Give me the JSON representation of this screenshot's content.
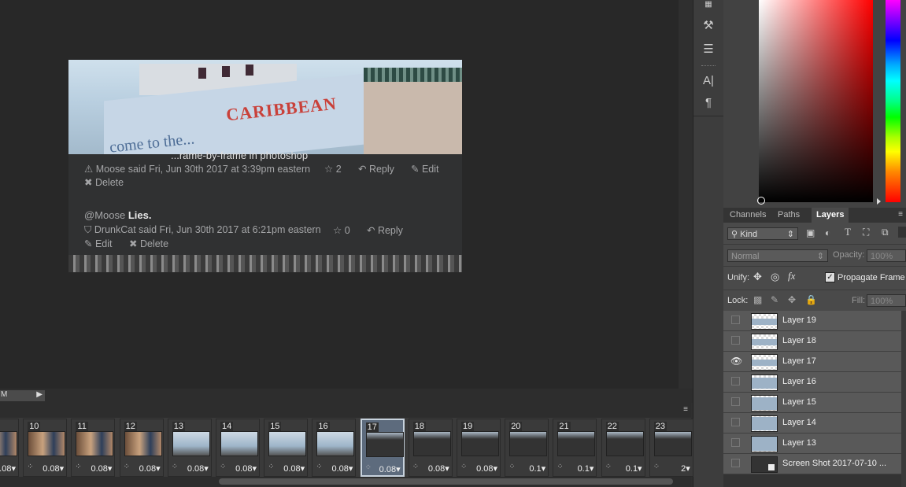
{
  "comments": [
    {
      "title_fragment": "...rame-by-frame in photoshop",
      "author": "Moose",
      "meta": "Moose said Fri, Jun 30th 2017 at 3:39pm eastern",
      "stars": "2",
      "reply": "Reply",
      "edit": "Edit",
      "delete": "Delete"
    },
    {
      "mention": "@Moose",
      "body": "Lies.",
      "meta": "DrunkCat said Fri, Jun 30th 2017 at 6:21pm eastern",
      "stars": "0",
      "reply": "Reply",
      "edit": "Edit",
      "delete": "Delete"
    }
  ],
  "photo_text": {
    "headline": "CARIBBEAN",
    "sub": "come to the..."
  },
  "layers_panel": {
    "tabs": [
      "Channels",
      "Paths",
      "Layers"
    ],
    "active_tab": "Layers",
    "filter_kind": "Kind",
    "blend_mode": "Normal",
    "opacity_label": "Opacity:",
    "opacity_value": "100%",
    "unify_label": "Unify:",
    "propagate_label": "Propagate Frame",
    "lock_label": "Lock:",
    "fill_label": "Fill:",
    "fill_value": "100%",
    "layers": [
      {
        "name": "Layer 19",
        "visible": false
      },
      {
        "name": "Layer 18",
        "visible": false
      },
      {
        "name": "Layer 17",
        "visible": true
      },
      {
        "name": "Layer 16",
        "visible": false
      },
      {
        "name": "Layer 15",
        "visible": false
      },
      {
        "name": "Layer 14",
        "visible": false
      },
      {
        "name": "Layer 13",
        "visible": false
      },
      {
        "name": "Screen Shot 2017-07-10 ...",
        "visible": false
      }
    ]
  },
  "timeline": {
    "scroll_label": "M",
    "frames": [
      {
        "num": "",
        "delay": "0.08▾"
      },
      {
        "num": "10",
        "delay": "0.08▾"
      },
      {
        "num": "11",
        "delay": "0.08▾"
      },
      {
        "num": "12",
        "delay": "0.08▾"
      },
      {
        "num": "13",
        "delay": "0.08▾"
      },
      {
        "num": "14",
        "delay": "0.08▾"
      },
      {
        "num": "15",
        "delay": "0.08▾"
      },
      {
        "num": "16",
        "delay": "0.08▾"
      },
      {
        "num": "17",
        "delay": "0.08▾",
        "selected": true
      },
      {
        "num": "18",
        "delay": "0.08▾"
      },
      {
        "num": "19",
        "delay": "0.08▾"
      },
      {
        "num": "20",
        "delay": "0.1▾"
      },
      {
        "num": "21",
        "delay": "0.1▾"
      },
      {
        "num": "22",
        "delay": "0.1▾"
      },
      {
        "num": "23",
        "delay": "2▾"
      }
    ]
  },
  "tools": [
    {
      "name": "hand-brush-icon",
      "glyph": "✋"
    },
    {
      "name": "adjustments-icon",
      "glyph": "⚙"
    },
    {
      "name": "character-icon",
      "glyph": "A|"
    },
    {
      "name": "paragraph-icon",
      "glyph": "¶"
    }
  ]
}
